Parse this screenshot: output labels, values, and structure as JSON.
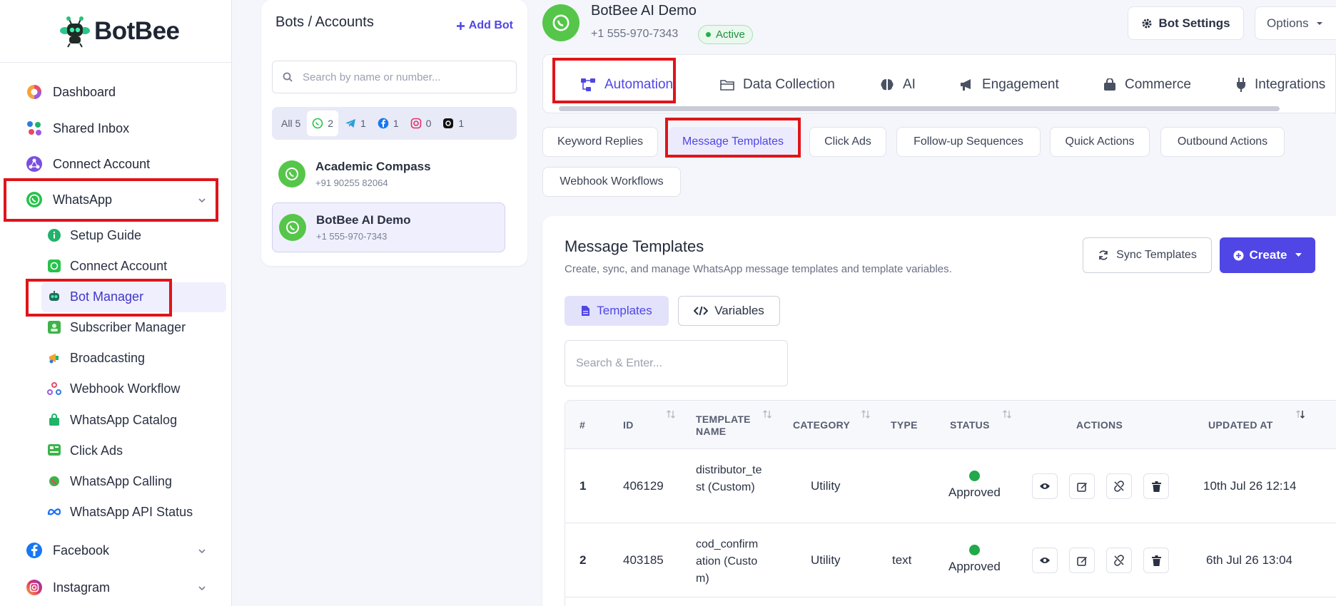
{
  "brand": {
    "name": "BotBee"
  },
  "sidebar": {
    "items": [
      {
        "label": "Dashboard"
      },
      {
        "label": "Shared Inbox"
      },
      {
        "label": "Connect Account"
      },
      {
        "label": "WhatsApp"
      },
      {
        "label": "Facebook"
      },
      {
        "label": "Instagram"
      }
    ],
    "whatsapp_sub": [
      {
        "label": "Setup Guide"
      },
      {
        "label": "Connect Account"
      },
      {
        "label": "Bot Manager"
      },
      {
        "label": "Subscriber Manager"
      },
      {
        "label": "Broadcasting"
      },
      {
        "label": "Webhook Workflow"
      },
      {
        "label": "WhatsApp Catalog"
      },
      {
        "label": "Click Ads"
      },
      {
        "label": "WhatsApp Calling"
      },
      {
        "label": "WhatsApp API Status"
      }
    ]
  },
  "bots_panel": {
    "title": "Bots / Accounts",
    "add_label": "Add Bot",
    "search_placeholder": "Search by name or number...",
    "filters": {
      "all": "All 5",
      "whatsapp": "2",
      "telegram": "1",
      "facebook": "1",
      "instagram": "0",
      "threads": "1"
    },
    "bots": [
      {
        "name": "Academic Compass",
        "number": "+91 90255 82064"
      },
      {
        "name": "BotBee AI Demo",
        "number": "+1 555-970-7343"
      }
    ]
  },
  "header": {
    "bot_name": "BotBee AI Demo",
    "bot_number": "+1 555-970-7343",
    "status": "Active",
    "settings_label": "Bot Settings",
    "options_label": "Options"
  },
  "tabs": [
    {
      "label": "Automation"
    },
    {
      "label": "Data Collection"
    },
    {
      "label": "AI"
    },
    {
      "label": "Engagement"
    },
    {
      "label": "Commerce"
    },
    {
      "label": "Integrations"
    }
  ],
  "subtabs": [
    {
      "label": "Keyword Replies"
    },
    {
      "label": "Message Templates"
    },
    {
      "label": "Click Ads"
    },
    {
      "label": "Follow-up Sequences"
    },
    {
      "label": "Quick Actions"
    },
    {
      "label": "Outbound Actions"
    },
    {
      "label": "Webhook Workflows"
    }
  ],
  "card": {
    "title": "Message Templates",
    "subtitle": "Create, sync, and manage WhatsApp message templates and template variables.",
    "sync_label": "Sync Templates",
    "create_label": "Create",
    "toggle_templates": "Templates",
    "toggle_variables": "Variables",
    "search_placeholder": "Search & Enter..."
  },
  "table": {
    "columns": {
      "num": "#",
      "id": "ID",
      "name": "TEMPLATE NAME",
      "category": "CATEGORY",
      "type": "TYPE",
      "status": "STATUS",
      "actions": "ACTIONS",
      "updated": "UPDATED AT"
    },
    "rows": [
      {
        "num": "1",
        "id": "406129",
        "name": "distributor_test (Custom)",
        "category": "Utility",
        "type": "",
        "status": "Approved",
        "updated": "10th Jul 26 12:14"
      },
      {
        "num": "2",
        "id": "403185",
        "name": "cod_confirmation (Custom)",
        "category": "Utility",
        "type": "text",
        "status": "Approved",
        "updated": "6th Jul 26 13:04"
      }
    ]
  },
  "colors": {
    "accent": "#4f46e5",
    "highlight": "#e0141a",
    "whatsapp": "#55c64a",
    "approved": "#21a94b"
  }
}
